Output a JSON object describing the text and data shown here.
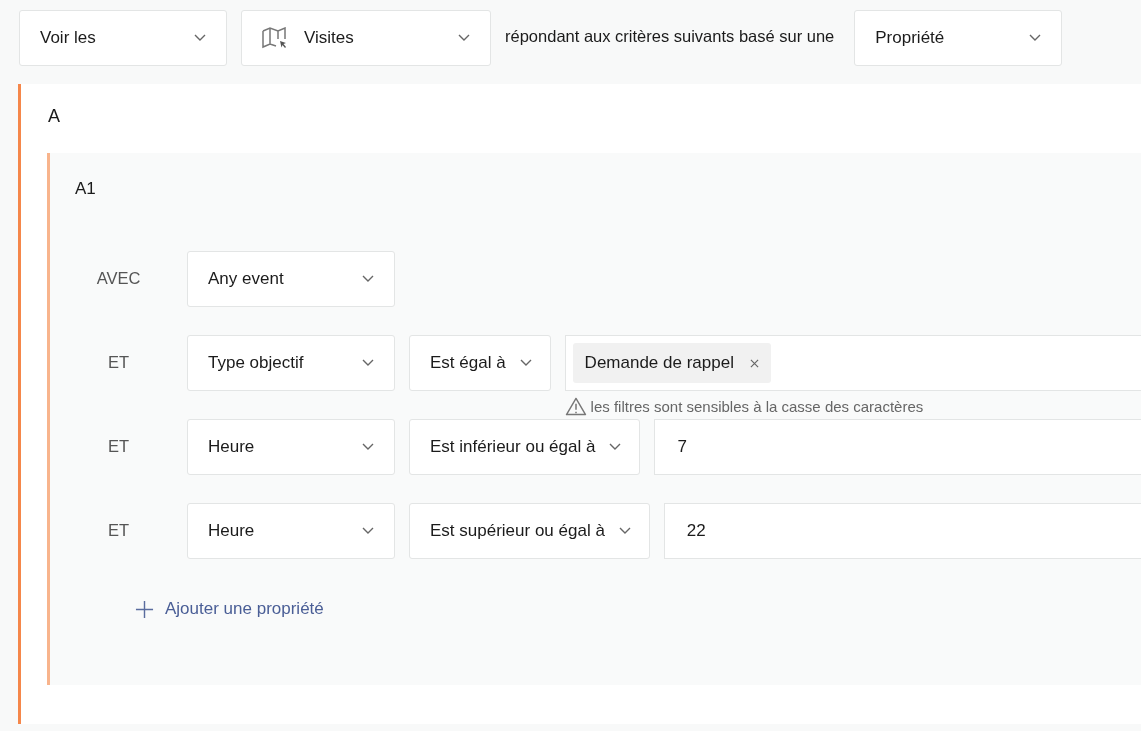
{
  "top_bar": {
    "show_select": {
      "value": "Voir les"
    },
    "entity_select": {
      "value": "Visites"
    },
    "sentence": "répondant aux critères suivants basé sur une",
    "basis_select": {
      "value": "Propriété"
    }
  },
  "group": {
    "title": "A",
    "subgroup": {
      "title": "A1",
      "rows": [
        {
          "kind": "event",
          "connector": "AVEC",
          "field": "Any event"
        },
        {
          "kind": "condition",
          "connector": "ET",
          "field": "Type objectif",
          "operator": "Est égal à",
          "tags": [
            "Demande de rappel"
          ],
          "note": "les filtres sont sensibles à la casse des caractères"
        },
        {
          "kind": "condition",
          "connector": "ET",
          "field": "Heure",
          "operator": "Est inférieur ou égal à",
          "value": "7"
        },
        {
          "kind": "condition",
          "connector": "ET",
          "field": "Heure",
          "operator": "Est supérieur ou égal à",
          "value": "22"
        }
      ],
      "add_button": "Ajouter une propriété"
    }
  }
}
